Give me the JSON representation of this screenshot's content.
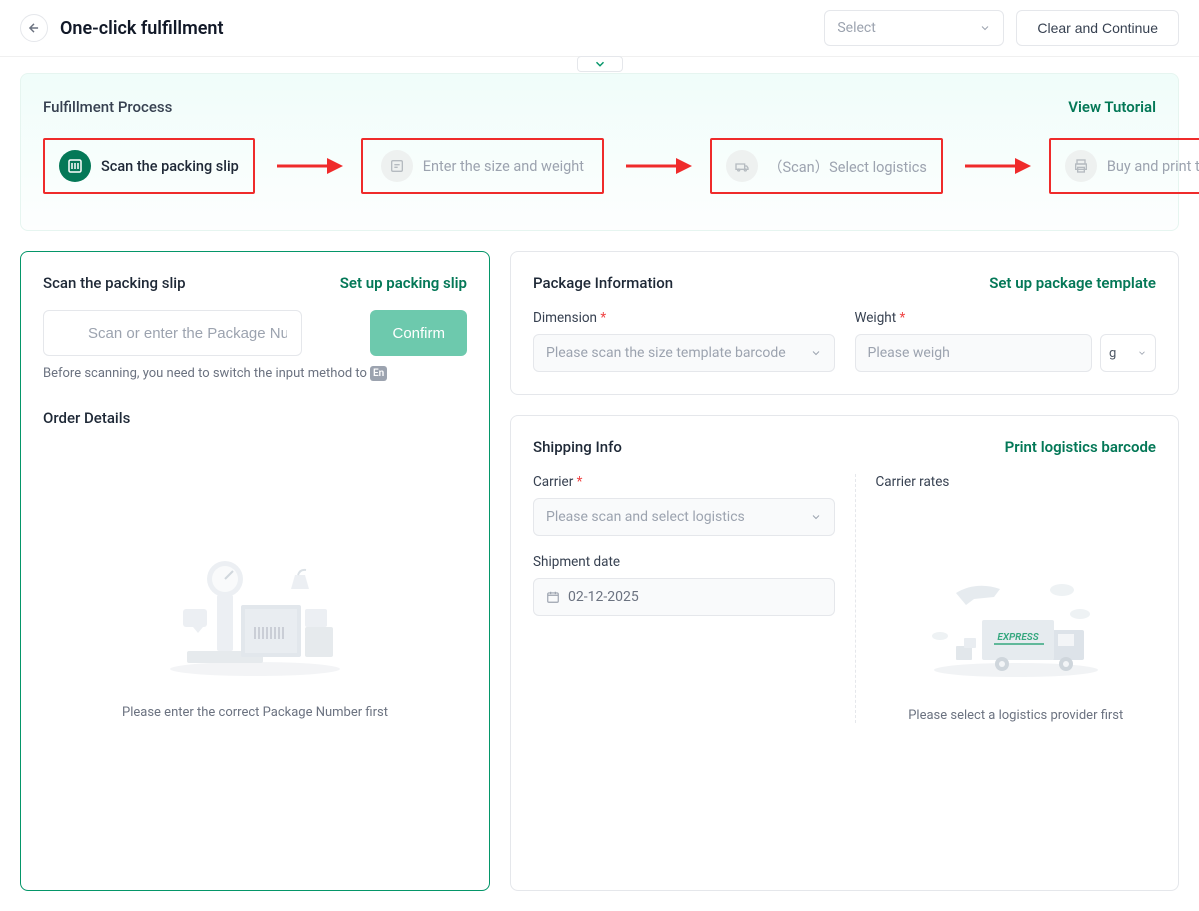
{
  "header": {
    "title": "One-click fulfillment",
    "select_placeholder": "Select",
    "clear_button": "Clear and Continue"
  },
  "process": {
    "title": "Fulfillment Process",
    "tutorial_link": "View Tutorial",
    "steps": [
      {
        "label": "Scan the packing slip"
      },
      {
        "label": "Enter the size and weight"
      },
      {
        "label": "（Scan）Select logistics"
      },
      {
        "label": "Buy and print the label"
      }
    ]
  },
  "scan_card": {
    "title": "Scan the packing slip",
    "setup_link": "Set up packing slip",
    "input_placeholder": "Scan or enter the Package Number",
    "confirm_button": "Confirm",
    "hint_prefix": "Before scanning, you need to switch the input method to",
    "hint_badge": "En",
    "order_details_title": "Order Details",
    "empty_text": "Please enter the correct Package Number first"
  },
  "package_card": {
    "title": "Package Information",
    "setup_link": "Set up package template",
    "dimension_label": "Dimension",
    "dimension_placeholder": "Please scan the size template barcode",
    "weight_label": "Weight",
    "weight_placeholder": "Please weigh",
    "weight_unit": "g"
  },
  "shipping_card": {
    "title": "Shipping Info",
    "barcode_link": "Print logistics barcode",
    "carrier_label": "Carrier",
    "carrier_placeholder": "Please scan and select logistics",
    "date_label": "Shipment date",
    "date_value": "02-12-2025",
    "rates_label": "Carrier rates",
    "rates_empty_text": "Please select a logistics provider first",
    "express_badge": "EXPRESS"
  }
}
